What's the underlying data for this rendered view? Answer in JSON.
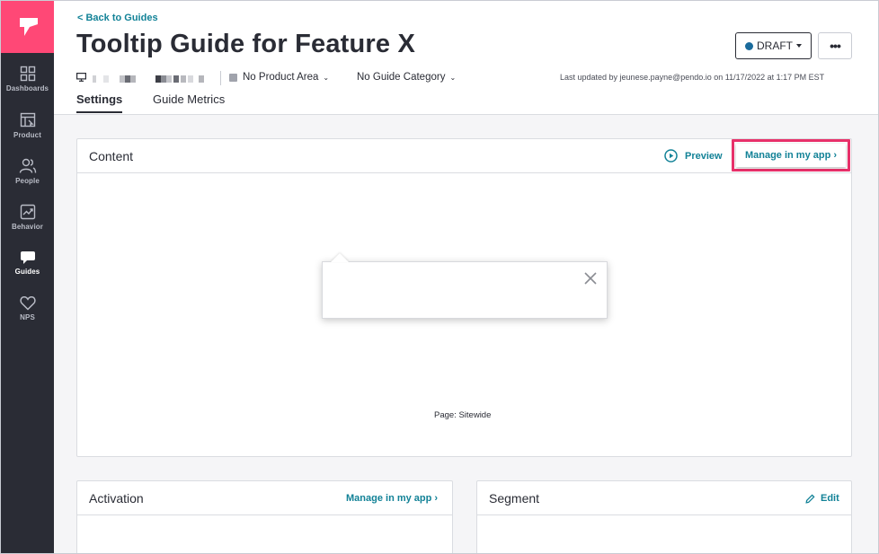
{
  "sidebar": {
    "logo_icon": "pendo-logo-icon",
    "items": [
      {
        "label": "Dashboards",
        "icon": "grid-icon"
      },
      {
        "label": "Product",
        "icon": "product-window-icon"
      },
      {
        "label": "People",
        "icon": "people-icon"
      },
      {
        "label": "Behavior",
        "icon": "trend-chart-icon"
      },
      {
        "label": "Guides",
        "icon": "speech-bubble-icon",
        "active": true
      },
      {
        "label": "NPS",
        "icon": "heart-icon"
      }
    ]
  },
  "header": {
    "back_link": "< Back to Guides",
    "title": "Tooltip Guide for Feature X",
    "status_button": "DRAFT",
    "status_color": "#1a6b9c",
    "more_button": "•••",
    "product_area": "No Product Area",
    "guide_category": "No Guide Category",
    "last_updated": "Last updated by jeunese.payne@pendo.io on 11/17/2022 at 1:17 PM EST"
  },
  "tabs": [
    {
      "label": "Settings",
      "active": true
    },
    {
      "label": "Guide Metrics",
      "active": false
    }
  ],
  "content_card": {
    "title": "Content",
    "preview_label": "Preview",
    "manage_label": "Manage in my app ›",
    "page_label": "Page: Sitewide"
  },
  "activation_card": {
    "title": "Activation",
    "manage_label": "Manage in my app ›"
  },
  "segment_card": {
    "title": "Segment",
    "edit_label": "Edit"
  },
  "colors": {
    "accent": "#128297",
    "brand": "#ff4876",
    "highlight": "#e8316a",
    "sidebar": "#2a2c35"
  }
}
